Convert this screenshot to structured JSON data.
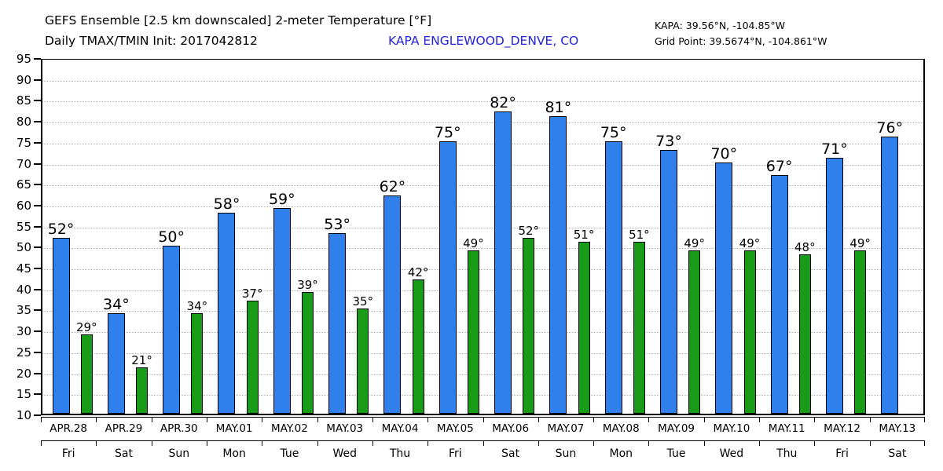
{
  "header": {
    "title_line1": "GEFS Ensemble [2.5 km downscaled] 2-meter Temperature [°F]",
    "title_line2": "Daily TMAX/TMIN Init: 2017042812",
    "station_name": "KAPA ENGLEWOOD_DENVE, CO",
    "station_coords": "KAPA: 39.56°N, -104.85°W",
    "grid_point_coords": "Grid Point: 39.5674°N, -104.861°W"
  },
  "colors": {
    "tmax": "#2f80ed",
    "tmin": "#189c18",
    "station_text": "#2323e0",
    "gridline": "#b4b4b4",
    "axis": "#000000"
  },
  "chart_data": {
    "type": "bar",
    "title": "GEFS Ensemble [2.5 km downscaled] 2-meter Temperature [°F]",
    "subtitle": "Daily TMAX/TMIN Init: 2017042812",
    "xlabel": "",
    "ylabel": "",
    "ylim": [
      10,
      95
    ],
    "ytick_step": 5,
    "yticks": [
      95,
      90,
      85,
      80,
      75,
      70,
      65,
      60,
      55,
      50,
      45,
      40,
      35,
      30,
      25,
      20,
      15,
      10
    ],
    "grid": true,
    "legend": "none",
    "categories": [
      "APR.28",
      "APR.29",
      "APR.30",
      "MAY.01",
      "MAY.02",
      "MAY.03",
      "MAY.04",
      "MAY.05",
      "MAY.06",
      "MAY.07",
      "MAY.08",
      "MAY.09",
      "MAY.10",
      "MAY.11",
      "MAY.12",
      "MAY.13"
    ],
    "weekdays": [
      "Fri",
      "Sat",
      "Sun",
      "Mon",
      "Tue",
      "Wed",
      "Thu",
      "Fri",
      "Sat",
      "Sun",
      "Mon",
      "Tue",
      "Wed",
      "Thu",
      "Fri",
      "Sat"
    ],
    "series": [
      {
        "name": "TMAX",
        "color": "#2f80ed",
        "values": [
          52,
          34,
          50,
          58,
          59,
          53,
          62,
          75,
          82,
          81,
          75,
          73,
          70,
          67,
          71,
          76
        ],
        "labels": [
          "52°",
          "34°",
          "50°",
          "58°",
          "59°",
          "53°",
          "62°",
          "75°",
          "82°",
          "81°",
          "75°",
          "73°",
          "70°",
          "67°",
          "71°",
          "76°"
        ]
      },
      {
        "name": "TMIN",
        "color": "#189c18",
        "values": [
          29,
          21,
          34,
          37,
          39,
          35,
          42,
          49,
          52,
          51,
          51,
          49,
          49,
          48,
          49
        ],
        "labels": [
          "29°",
          "21°",
          "34°",
          "37°",
          "39°",
          "35°",
          "42°",
          "49°",
          "52°",
          "51°",
          "51°",
          "49°",
          "49°",
          "48°",
          "49°"
        ]
      }
    ]
  }
}
